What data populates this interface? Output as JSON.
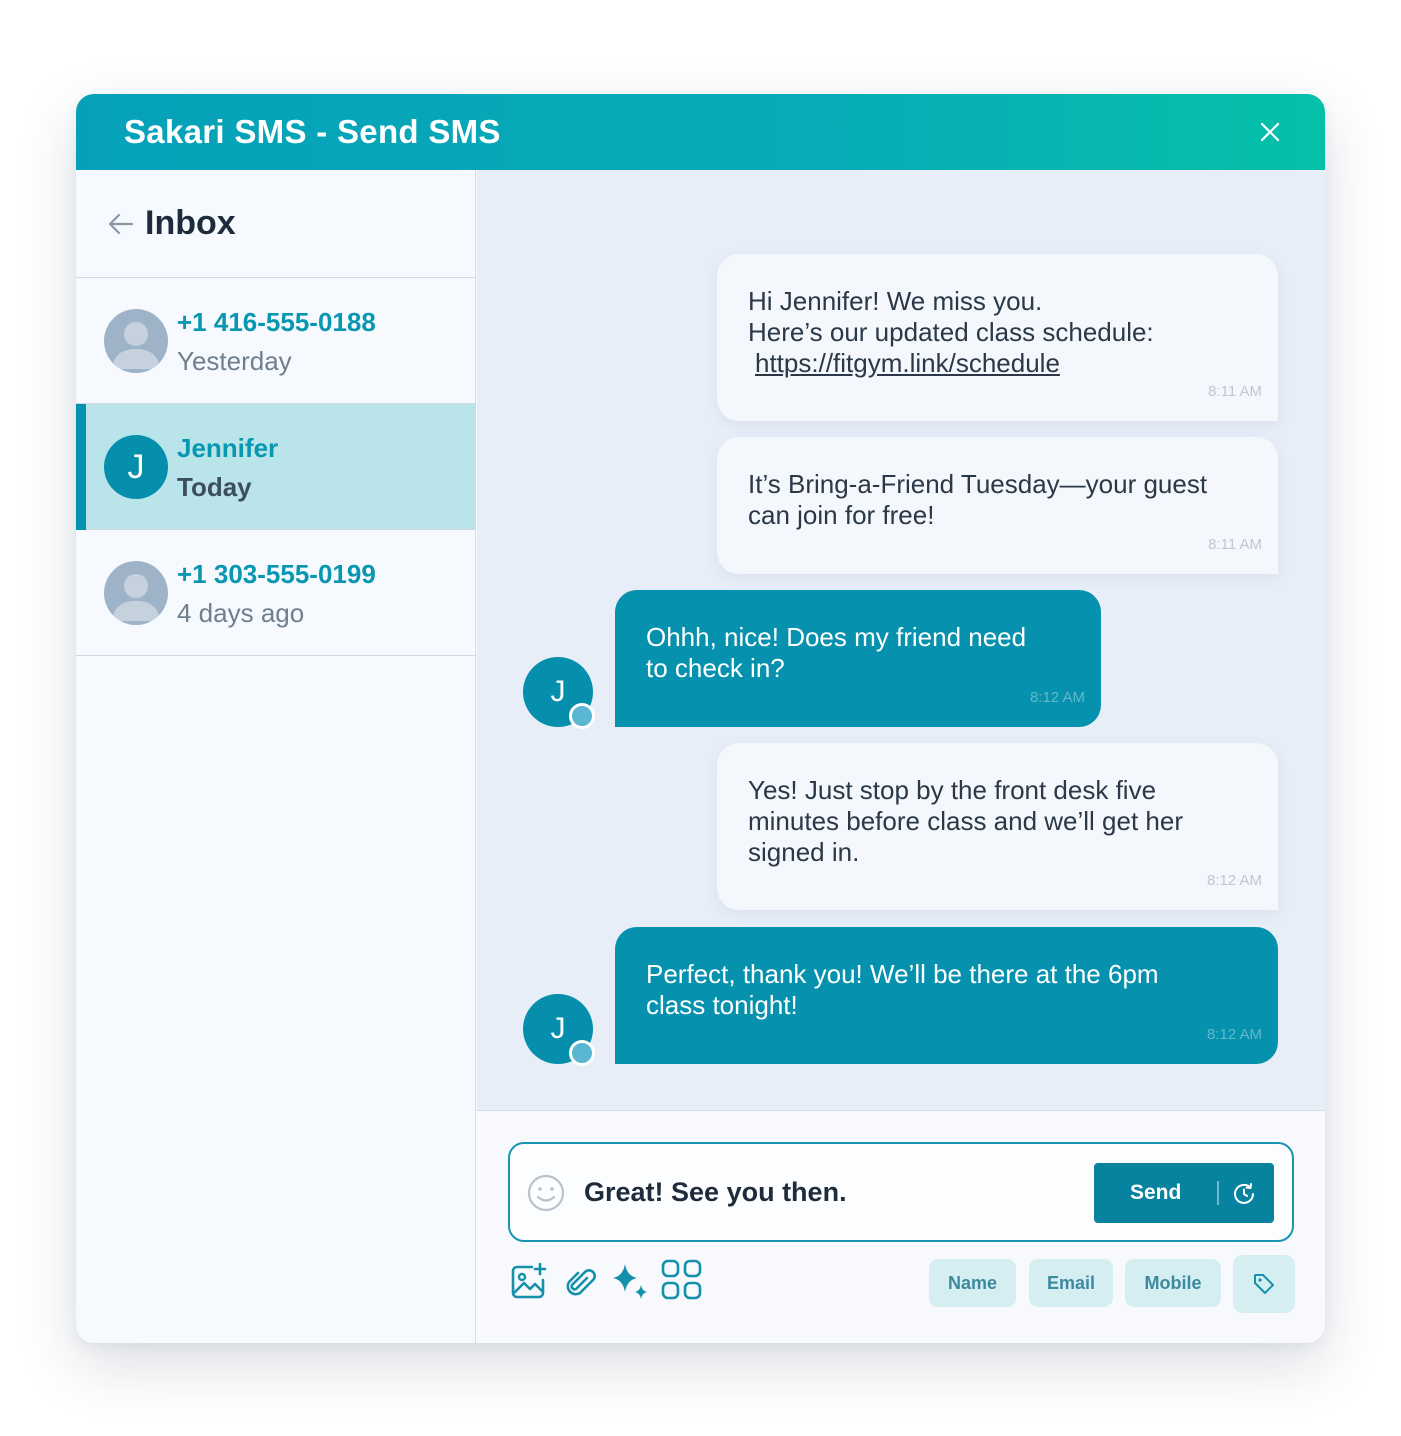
{
  "window": {
    "title": "Sakari SMS - Send SMS"
  },
  "sidebar": {
    "title": "Inbox",
    "conversations": [
      {
        "name": "+1 416-555-0188",
        "time": "Yesterday",
        "active": false
      },
      {
        "name": "Jennifer",
        "time": "Today",
        "active": true,
        "initial": "J"
      },
      {
        "name": "+1 303-555-0199",
        "time": "4 days ago",
        "active": false
      }
    ]
  },
  "messages": [
    {
      "direction": "outgoing",
      "lines": [
        "Hi Jennifer! We miss you.",
        "Here’s our updated class schedule:"
      ],
      "link": "https://fitgym.link/schedule",
      "time": "8:11 AM"
    },
    {
      "direction": "outgoing",
      "lines": [
        "It’s Bring-a-Friend Tuesday—your guest",
        "can join for free!"
      ],
      "time": "8:11 AM"
    },
    {
      "direction": "incoming",
      "lines": [
        "Ohhh, nice! Does my friend need",
        "to check in?"
      ],
      "time": "8:12 AM",
      "avatar": "J"
    },
    {
      "direction": "outgoing",
      "lines": [
        "Yes! Just stop by the front desk five",
        "minutes before class and we’ll get her",
        "signed in."
      ],
      "time": "8:12 AM"
    },
    {
      "direction": "incoming",
      "lines": [
        "Perfect, thank you! We’ll be there at the 6pm",
        "class tonight!"
      ],
      "time": "8:12 AM",
      "avatar": "J"
    }
  ],
  "composer": {
    "value": "Great! See you then.",
    "send_label": "Send",
    "chips": [
      "Name",
      "Email",
      "Mobile"
    ]
  },
  "colors": {
    "brand": "#0692ae",
    "header_gradient_start": "#06a1b9",
    "header_gradient_end": "#05c0a9",
    "active_conversation": "#b8e4ea"
  }
}
